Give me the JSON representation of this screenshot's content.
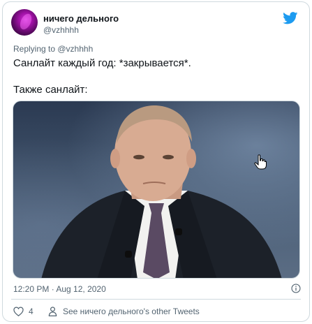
{
  "author": {
    "name": "ничего дельного",
    "handle": "@vzhhhh"
  },
  "tweet": {
    "replying_prefix": "Replying to ",
    "replying_to": "@vzhhhh",
    "text": "Санлайт каждый год: *закрывается*.\n\nТакже санлайт:",
    "timestamp": "12:20 PM · Aug 12, 2020"
  },
  "actions": {
    "like_count": "4",
    "other_tweets_label": "See ничего дельного's other Tweets"
  },
  "icons": {
    "brand": "twitter-logo-icon",
    "info": "info-icon",
    "like": "heart-icon",
    "profile": "person-icon",
    "cursor": "hand-pointer-icon"
  },
  "colors": {
    "twitter_blue": "#1d9bf0",
    "secondary_text": "#536471",
    "border": "#cfd9de"
  }
}
